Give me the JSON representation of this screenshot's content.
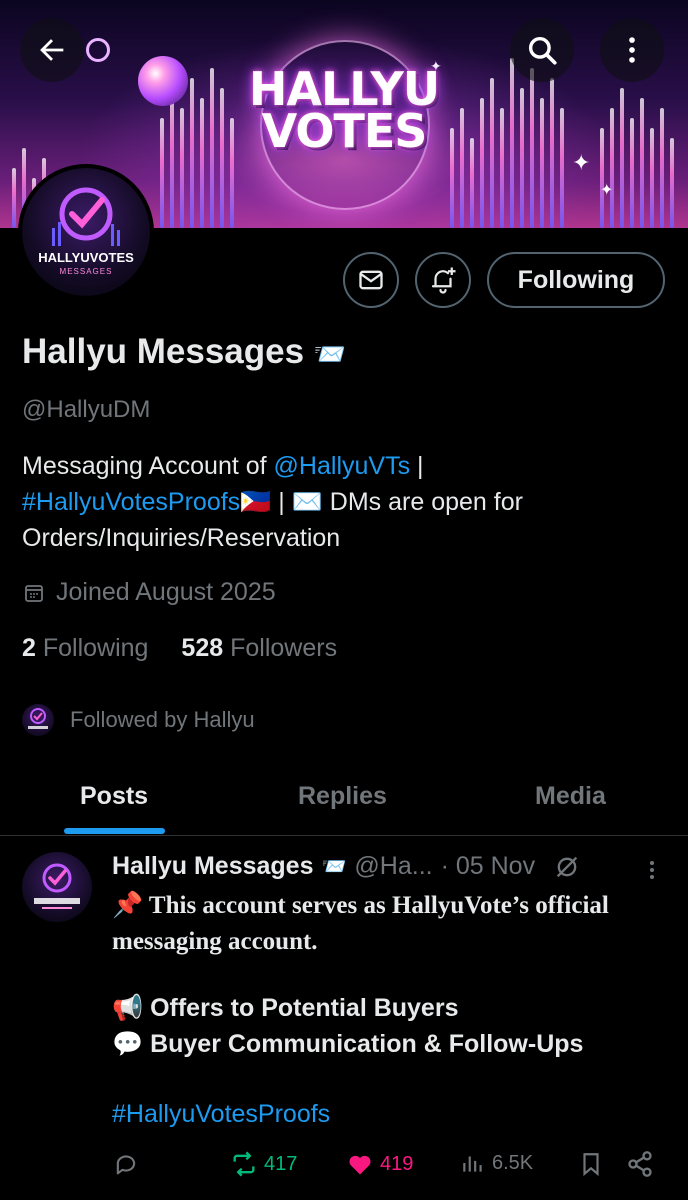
{
  "banner": {
    "line1": "HALLYU",
    "line2": "VOTES"
  },
  "avatar": {
    "brand": "HALLYUVOTES",
    "sub": "MESSAGES"
  },
  "profile": {
    "name": "Hallyu Messages",
    "name_emoji": "📨",
    "handle": "@HallyuDM",
    "bio_prefix": "Messaging Account of ",
    "bio_mention": "@HallyuVTs",
    "bio_sep1": " |",
    "bio_hashtag": "#HallyuVotesProofs",
    "bio_flag": "🇵🇭",
    "bio_sep2": " |  ",
    "bio_mail": "✉️",
    "bio_line2_rest": " DMs are open for",
    "bio_line3": "Orders/Inquiries/Reservation",
    "joined": "Joined August 2025",
    "following_count": "2",
    "following_label": "Following",
    "followers_count": "528",
    "followers_label": "Followers",
    "followed_by": "Followed by Hallyu"
  },
  "buttons": {
    "follow_label": "Following"
  },
  "tabs": [
    {
      "label": "Posts"
    },
    {
      "label": "Replies"
    },
    {
      "label": "Media"
    }
  ],
  "post": {
    "author": "Hallyu Messages",
    "author_emoji": "📨",
    "handle": "@Ha...",
    "date": "· 05 Nov",
    "line1": "📌 This account serves as HallyuVote’s official",
    "line2": "messaging account.",
    "offer": "📢 Offers to Potential Buyers",
    "comm": "💬 Buyer Communication & Follow-Ups",
    "hashtag": "#HallyuVotesProofs",
    "reposts": "417",
    "likes": "419",
    "views": "6.5K"
  },
  "colors": {
    "accent": "#1d9bf0",
    "repost": "#00ba7c",
    "like": "#f91880",
    "muted": "#71767b"
  }
}
